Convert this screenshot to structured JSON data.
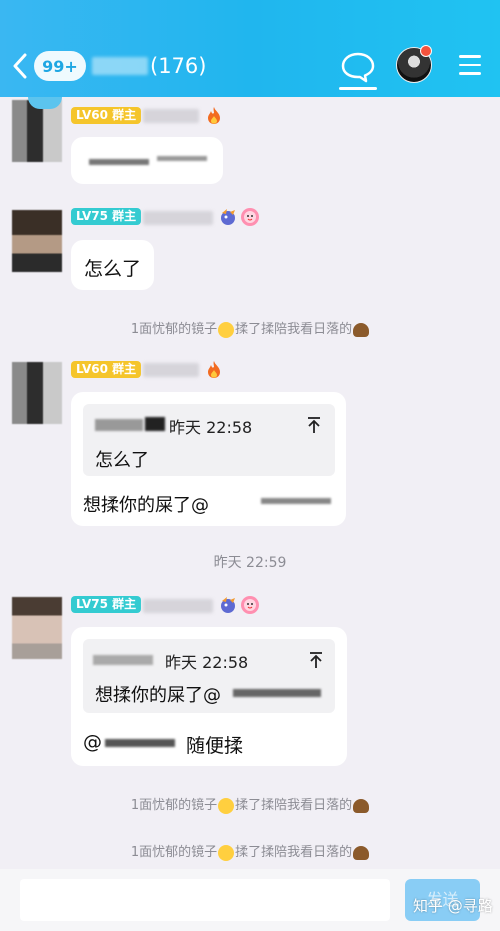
{
  "header": {
    "unread_badge": "99+",
    "member_count": "(176)",
    "colors": {
      "background": "#20b6ee",
      "notification_dot": "#f5533d"
    }
  },
  "messages": [
    {
      "level_badge": "LV60",
      "role_badge": "群主",
      "text": ""
    },
    {
      "level_badge": "LV75",
      "role_badge": "群主",
      "text": "怎么了"
    },
    {
      "level_badge": "LV60",
      "role_badge": "群主",
      "quote_time": "昨天 22:58",
      "quote_text": "怎么了",
      "text": "想揉你的屎了@"
    },
    {
      "level_badge": "LV75",
      "role_badge": "群主",
      "quote_time": "昨天 22:58",
      "quote_text": "想揉你的屎了@",
      "text": "随便揉",
      "mention_prefix": "@"
    }
  ],
  "system_messages": [
    {
      "name": "1面忧郁的镜子",
      "action": "揉了揉陪我看日落的"
    },
    {
      "name": "1面忧郁的镜子",
      "action": "揉了揉陪我看日落的"
    },
    {
      "name": "1面忧郁的镜子",
      "action": "揉了揉陪我看日落的"
    }
  ],
  "timestamp_divider": "昨天 22:59",
  "composer": {
    "send_label": "发送",
    "watermark": "知乎 @寻路"
  }
}
